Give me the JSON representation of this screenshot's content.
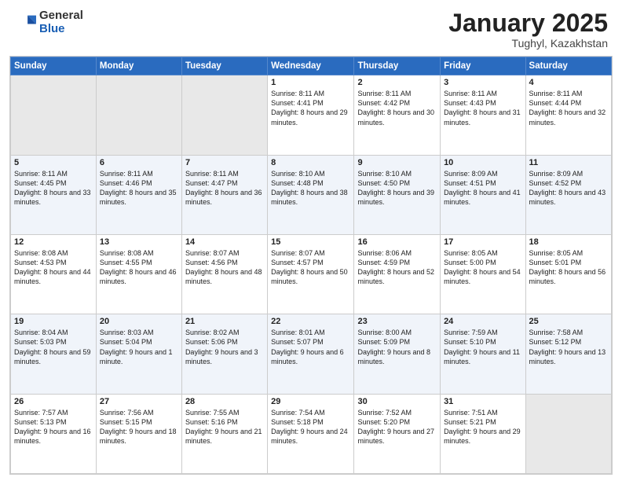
{
  "logo": {
    "general": "General",
    "blue": "Blue"
  },
  "header": {
    "month": "January 2025",
    "location": "Tughyl, Kazakhstan"
  },
  "weekdays": [
    "Sunday",
    "Monday",
    "Tuesday",
    "Wednesday",
    "Thursday",
    "Friday",
    "Saturday"
  ],
  "weeks": [
    [
      {
        "day": "",
        "empty": true
      },
      {
        "day": "",
        "empty": true
      },
      {
        "day": "",
        "empty": true
      },
      {
        "day": "1",
        "sunrise": "8:11 AM",
        "sunset": "4:41 PM",
        "daylight": "8 hours and 29 minutes"
      },
      {
        "day": "2",
        "sunrise": "8:11 AM",
        "sunset": "4:42 PM",
        "daylight": "8 hours and 30 minutes"
      },
      {
        "day": "3",
        "sunrise": "8:11 AM",
        "sunset": "4:43 PM",
        "daylight": "8 hours and 31 minutes"
      },
      {
        "day": "4",
        "sunrise": "8:11 AM",
        "sunset": "4:44 PM",
        "daylight": "8 hours and 32 minutes"
      }
    ],
    [
      {
        "day": "5",
        "sunrise": "8:11 AM",
        "sunset": "4:45 PM",
        "daylight": "8 hours and 33 minutes"
      },
      {
        "day": "6",
        "sunrise": "8:11 AM",
        "sunset": "4:46 PM",
        "daylight": "8 hours and 35 minutes"
      },
      {
        "day": "7",
        "sunrise": "8:11 AM",
        "sunset": "4:47 PM",
        "daylight": "8 hours and 36 minutes"
      },
      {
        "day": "8",
        "sunrise": "8:10 AM",
        "sunset": "4:48 PM",
        "daylight": "8 hours and 38 minutes"
      },
      {
        "day": "9",
        "sunrise": "8:10 AM",
        "sunset": "4:50 PM",
        "daylight": "8 hours and 39 minutes"
      },
      {
        "day": "10",
        "sunrise": "8:09 AM",
        "sunset": "4:51 PM",
        "daylight": "8 hours and 41 minutes"
      },
      {
        "day": "11",
        "sunrise": "8:09 AM",
        "sunset": "4:52 PM",
        "daylight": "8 hours and 43 minutes"
      }
    ],
    [
      {
        "day": "12",
        "sunrise": "8:08 AM",
        "sunset": "4:53 PM",
        "daylight": "8 hours and 44 minutes"
      },
      {
        "day": "13",
        "sunrise": "8:08 AM",
        "sunset": "4:55 PM",
        "daylight": "8 hours and 46 minutes"
      },
      {
        "day": "14",
        "sunrise": "8:07 AM",
        "sunset": "4:56 PM",
        "daylight": "8 hours and 48 minutes"
      },
      {
        "day": "15",
        "sunrise": "8:07 AM",
        "sunset": "4:57 PM",
        "daylight": "8 hours and 50 minutes"
      },
      {
        "day": "16",
        "sunrise": "8:06 AM",
        "sunset": "4:59 PM",
        "daylight": "8 hours and 52 minutes"
      },
      {
        "day": "17",
        "sunrise": "8:05 AM",
        "sunset": "5:00 PM",
        "daylight": "8 hours and 54 minutes"
      },
      {
        "day": "18",
        "sunrise": "8:05 AM",
        "sunset": "5:01 PM",
        "daylight": "8 hours and 56 minutes"
      }
    ],
    [
      {
        "day": "19",
        "sunrise": "8:04 AM",
        "sunset": "5:03 PM",
        "daylight": "8 hours and 59 minutes"
      },
      {
        "day": "20",
        "sunrise": "8:03 AM",
        "sunset": "5:04 PM",
        "daylight": "9 hours and 1 minute"
      },
      {
        "day": "21",
        "sunrise": "8:02 AM",
        "sunset": "5:06 PM",
        "daylight": "9 hours and 3 minutes"
      },
      {
        "day": "22",
        "sunrise": "8:01 AM",
        "sunset": "5:07 PM",
        "daylight": "9 hours and 6 minutes"
      },
      {
        "day": "23",
        "sunrise": "8:00 AM",
        "sunset": "5:09 PM",
        "daylight": "9 hours and 8 minutes"
      },
      {
        "day": "24",
        "sunrise": "7:59 AM",
        "sunset": "5:10 PM",
        "daylight": "9 hours and 11 minutes"
      },
      {
        "day": "25",
        "sunrise": "7:58 AM",
        "sunset": "5:12 PM",
        "daylight": "9 hours and 13 minutes"
      }
    ],
    [
      {
        "day": "26",
        "sunrise": "7:57 AM",
        "sunset": "5:13 PM",
        "daylight": "9 hours and 16 minutes"
      },
      {
        "day": "27",
        "sunrise": "7:56 AM",
        "sunset": "5:15 PM",
        "daylight": "9 hours and 18 minutes"
      },
      {
        "day": "28",
        "sunrise": "7:55 AM",
        "sunset": "5:16 PM",
        "daylight": "9 hours and 21 minutes"
      },
      {
        "day": "29",
        "sunrise": "7:54 AM",
        "sunset": "5:18 PM",
        "daylight": "9 hours and 24 minutes"
      },
      {
        "day": "30",
        "sunrise": "7:52 AM",
        "sunset": "5:20 PM",
        "daylight": "9 hours and 27 minutes"
      },
      {
        "day": "31",
        "sunrise": "7:51 AM",
        "sunset": "5:21 PM",
        "daylight": "9 hours and 29 minutes"
      },
      {
        "day": "",
        "empty": true
      }
    ]
  ]
}
